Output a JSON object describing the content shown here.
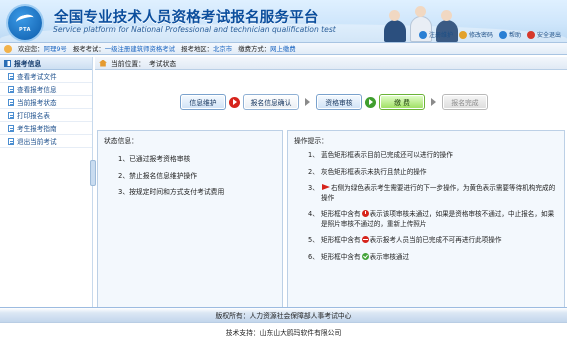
{
  "header": {
    "title": "全国专业技术人员资格考试报名服务平台",
    "subtitle": "Service platform for National Professional and technician qualification test",
    "links": [
      {
        "label": "注册维护",
        "icon": "globe-icon",
        "color": "#2a7fd4"
      },
      {
        "label": "修改密码",
        "icon": "key-icon",
        "color": "#e3a12b"
      },
      {
        "label": "帮助",
        "icon": "help-icon",
        "color": "#2a7fd4"
      },
      {
        "label": "安全退出",
        "icon": "power-icon",
        "color": "#d6382b"
      }
    ]
  },
  "infobar": {
    "welcome_label": "欢迎您：",
    "welcome_value": "阿理9号",
    "exam_label": "报考考试：",
    "exam_value": "一级注册建筑师资格考试",
    "area_label": "报考地区：",
    "area_value": "北京市",
    "fee_label": "缴费方式：",
    "fee_value": "网上缴费"
  },
  "sidebar": {
    "heading": "报考信息",
    "items": [
      {
        "label": "查看考试文件"
      },
      {
        "label": "查看报考信息"
      },
      {
        "label": "当前报考状态"
      },
      {
        "label": "打印报名表"
      },
      {
        "label": "考生报考指南"
      },
      {
        "label": "退出当前考试"
      }
    ]
  },
  "breadcrumb": {
    "label": "当前位置：",
    "current": "考试状态"
  },
  "steps": [
    {
      "label": "信息维护",
      "state": "blue"
    },
    {
      "label": "报名信息确认",
      "state": "plain"
    },
    {
      "label": "资格审核",
      "state": "blue"
    },
    {
      "label": "缴 费",
      "state": "current"
    },
    {
      "label": "报名完成",
      "state": "gray"
    }
  ],
  "status_panel": {
    "title": "状态信息：",
    "lines": [
      "1、已通过报考资格审核",
      "2、禁止报名信息维护操作",
      "3、按规定时间和方式支付考试费用"
    ]
  },
  "tips_panel": {
    "title": "操作提示：",
    "tips": [
      {
        "num": "1、",
        "pre": "蓝色矩形框表示目前已完成还可以进行的操作",
        "icon": "",
        "post": ""
      },
      {
        "num": "2、",
        "pre": "灰色矩形框表示未执行且禁止的操作",
        "icon": "",
        "post": ""
      },
      {
        "num": "3、",
        "pre": "",
        "icon": "go",
        "post": "右侧为绿色表示考生需要进行的下一步操作，为黄色表示需要等待机构完成的操作"
      },
      {
        "num": "4、",
        "pre": "矩形框中含有",
        "icon": "red",
        "post": "表示该项审核未通过，如果是资格审核不通过，中止报名，如果是照片审核不通过的，重新上传照片"
      },
      {
        "num": "5、",
        "pre": "矩形框中含有",
        "icon": "stop",
        "post": "表示报考人员当前已完成不可再进行此项操作"
      },
      {
        "num": "6、",
        "pre": "矩形框中含有",
        "icon": "ok",
        "post": "表示审核通过"
      }
    ]
  },
  "footer": {
    "copyright": "版权所有：人力资源社会保障部人事考试中心",
    "tech": "技术支持：山东山大鸥玛软件有限公司"
  }
}
